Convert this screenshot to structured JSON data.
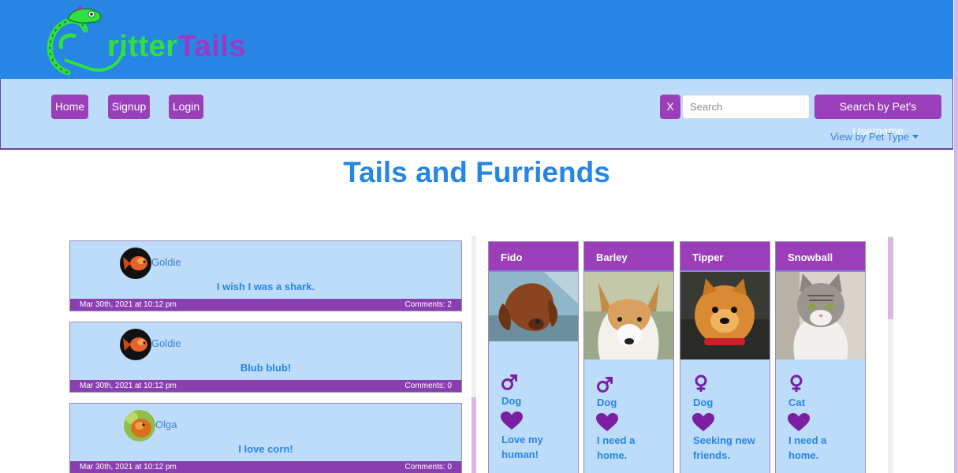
{
  "brand": {
    "logo_text_part1": "ritter",
    "logo_text_part2": "Tails",
    "colors": {
      "header_bg": "#2786e4",
      "nav_bg": "#bddcf9",
      "accent_purple": "#9a3fb9",
      "logo_green": "#2fe040"
    },
    "logo_icon": "chameleon-icon"
  },
  "nav": {
    "home_label": "Home",
    "signup_label": "Signup",
    "login_label": "Login",
    "clear_label": "X",
    "search_placeholder": "Search",
    "search_value": "",
    "search_button_label": "Search by Pet's Username",
    "view_type_label": "View by Pet Type"
  },
  "page": {
    "title": "Tails and Furriends"
  },
  "posts": [
    {
      "username": "Goldie",
      "text": "I wish I was a shark.",
      "date": "Mar 30th, 2021 at 10:12 pm",
      "comments": "Comments: 2",
      "avatar": "goldfish-avatar"
    },
    {
      "username": "Goldie",
      "text": "Blub blub!",
      "date": "Mar 30th, 2021 at 10:12 pm",
      "comments": "Comments: 0",
      "avatar": "goldfish-avatar"
    },
    {
      "username": "Olga",
      "text": "I love corn!",
      "date": "Mar 30th, 2021 at 10:12 pm",
      "comments": "Comments: 0",
      "avatar": "orange-pet-avatar"
    }
  ],
  "pets": [
    {
      "name": "Fido",
      "gender_icon": "male-icon",
      "type": "Dog",
      "description": "Love my human!",
      "photo": "brown-dog-photo"
    },
    {
      "name": "Barley",
      "gender_icon": "male-icon",
      "type": "Dog",
      "description": "I need a home.",
      "photo": "white-dog-photo"
    },
    {
      "name": "Tipper",
      "gender_icon": "female-icon",
      "type": "Dog",
      "description": "Seeking new friends.",
      "photo": "pomeranian-photo"
    },
    {
      "name": "Snowball",
      "gender_icon": "female-icon",
      "type": "Cat",
      "description": "I need a home.",
      "photo": "tabby-cat-photo"
    }
  ]
}
